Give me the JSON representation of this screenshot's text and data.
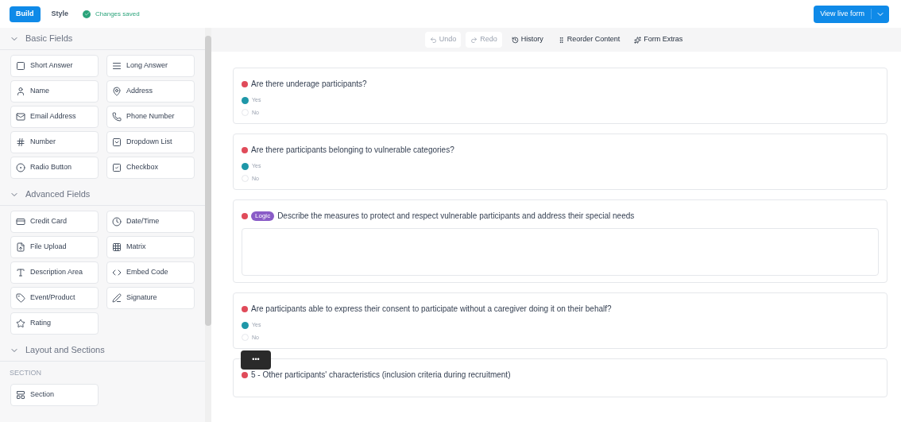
{
  "topbar": {
    "tabs": [
      {
        "label": "Build",
        "selected": true
      },
      {
        "label": "Style",
        "selected": false
      }
    ],
    "status": "Changes saved",
    "primary_button": "View live form"
  },
  "sidebar": {
    "groups": [
      {
        "title": "Basic Fields",
        "expanded": true,
        "items": [
          {
            "label": "Short Answer"
          },
          {
            "label": "Long Answer"
          },
          {
            "label": "Name"
          },
          {
            "label": "Address"
          },
          {
            "label": "Email Address"
          },
          {
            "label": "Phone Number"
          },
          {
            "label": "Number"
          },
          {
            "label": "Dropdown List"
          },
          {
            "label": "Radio Button"
          },
          {
            "label": "Checkbox"
          }
        ]
      },
      {
        "title": "Advanced Fields",
        "expanded": true,
        "items": [
          {
            "label": "Credit Card"
          },
          {
            "label": "Date/Time"
          },
          {
            "label": "File Upload"
          },
          {
            "label": "Matrix"
          },
          {
            "label": "Description Area"
          },
          {
            "label": "Embed Code"
          },
          {
            "label": "Event/Product"
          },
          {
            "label": "Signature"
          },
          {
            "label": "Rating"
          }
        ]
      },
      {
        "title": "Layout and Sections",
        "expanded": true,
        "subheading": "SECTION",
        "items": [
          {
            "label": "Section"
          }
        ]
      }
    ]
  },
  "toolbar": [
    {
      "label": "Undo",
      "disabled": true
    },
    {
      "label": "Redo",
      "disabled": true
    },
    {
      "label": "History",
      "disabled": false
    },
    {
      "label": "Reorder Content",
      "disabled": false
    },
    {
      "label": "Form Extras",
      "disabled": false
    }
  ],
  "questions": [
    {
      "kind": "choice",
      "title": "Are there underage participants?",
      "options": [
        {
          "label": "Yes",
          "selected": true
        },
        {
          "label": "No",
          "selected": false
        }
      ]
    },
    {
      "kind": "choice",
      "title": "Are there participants belonging to vulnerable categories?",
      "options": [
        {
          "label": "Yes",
          "selected": true
        },
        {
          "label": "No",
          "selected": false
        }
      ]
    },
    {
      "kind": "text",
      "badge": "Logic",
      "title": "Describe the measures to protect and respect vulnerable participants and address their special needs"
    },
    {
      "kind": "choice",
      "title": "Are participants able to express their consent to participate without a caregiver doing it on their behalf?",
      "options": [
        {
          "label": "Yes",
          "selected": true
        },
        {
          "label": "No",
          "selected": false
        }
      ]
    },
    {
      "kind": "section",
      "title": "5 - Other participants' characteristics (inclusion criteria during recruitment)"
    }
  ],
  "more_button": "•••"
}
